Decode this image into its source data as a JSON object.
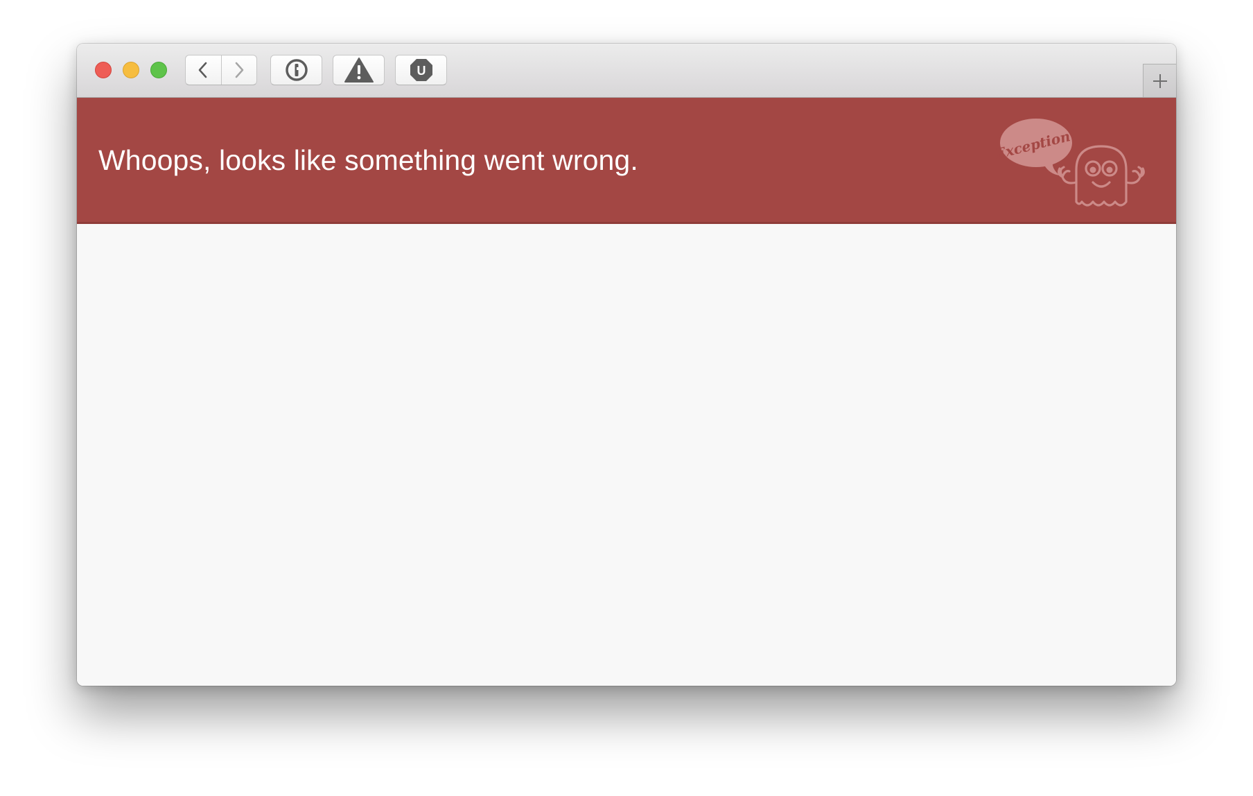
{
  "window": {
    "traffic_lights": {
      "close": "close",
      "minimize": "minimize",
      "maximize": "maximize"
    }
  },
  "toolbar": {
    "back_icon": "chevron-left-icon",
    "forward_icon": "chevron-right-icon",
    "extensions": [
      {
        "name": "1password-icon"
      },
      {
        "name": "warning-icon"
      },
      {
        "name": "ublock-icon",
        "glyph": "U"
      }
    ],
    "new_tab_icon": "plus-icon"
  },
  "page": {
    "error_title": "Whoops, looks like something went wrong.",
    "mascot_bubble_text": "Exception!",
    "colors": {
      "header_background": "#a34744",
      "page_background": "#f8f8f8"
    }
  }
}
